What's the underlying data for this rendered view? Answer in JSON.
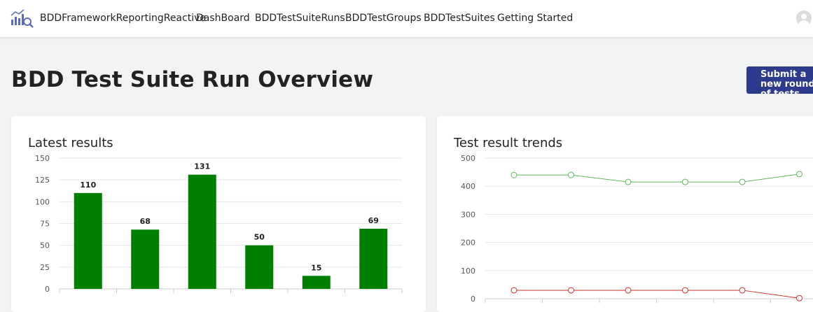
{
  "navbar": {
    "brand": "BDDFrameworkReportingReactive",
    "links": [
      "DashBoard",
      "BDDTestSuiteRuns",
      "BDDTestGroups",
      "BDDTestSuites",
      "Getting Started"
    ]
  },
  "page": {
    "title": "BDD Test Suite Run Overview",
    "submit_button": "Submit a new round of tests"
  },
  "colors": {
    "bar": "#008000",
    "pass_line": "#5cb85c",
    "fail_line": "#c9302c",
    "button": "#2e3a8c"
  },
  "chart_data": [
    {
      "type": "bar",
      "title": "Latest results",
      "categories": [
        "",
        "",
        "",
        "",
        "",
        ""
      ],
      "values": [
        110,
        68,
        131,
        50,
        15,
        69
      ],
      "ylim": [
        0,
        150
      ],
      "yticks": [
        0,
        25,
        50,
        75,
        100,
        125,
        150
      ],
      "grid": true
    },
    {
      "type": "line",
      "title": "Test result trends",
      "x": [
        1,
        2,
        3,
        4,
        5,
        6
      ],
      "series": [
        {
          "values": [
            440,
            440,
            415,
            415,
            415,
            443
          ]
        },
        {
          "values": [
            30,
            30,
            30,
            30,
            30,
            2
          ]
        }
      ],
      "ylim": [
        0,
        500
      ],
      "yticks": [
        0,
        100,
        200,
        300,
        400,
        500
      ],
      "grid": true
    }
  ]
}
